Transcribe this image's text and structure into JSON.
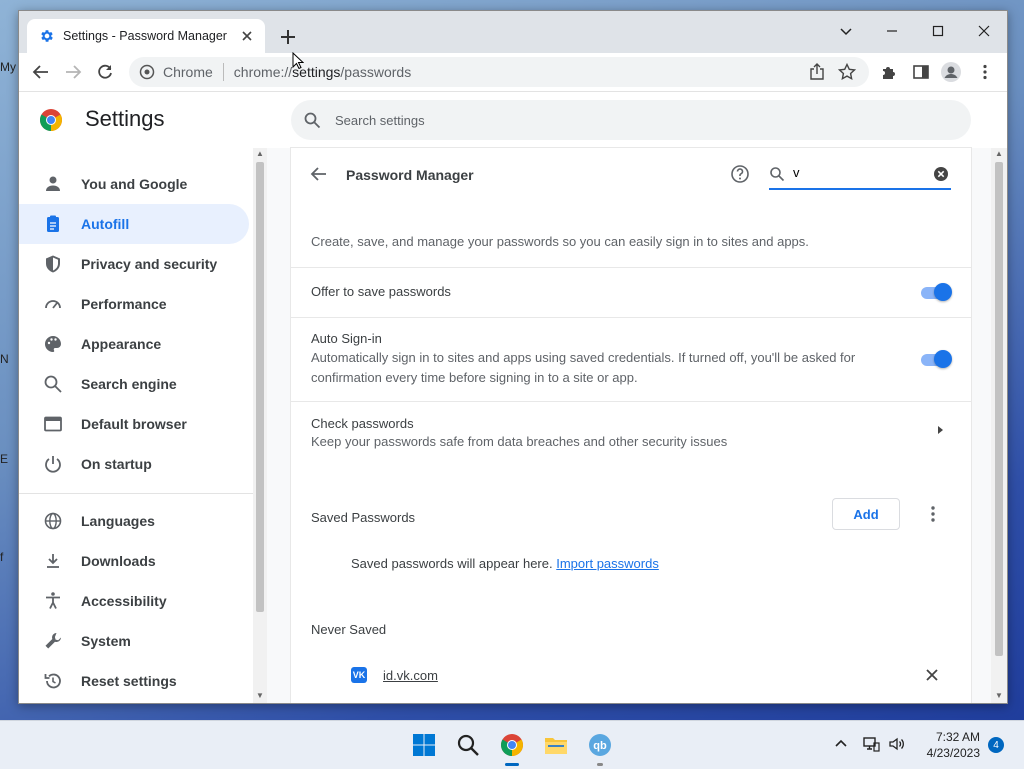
{
  "browser": {
    "tab_title": "Settings - Password Manager",
    "omnibox_chip": "Chrome",
    "url_prefix": "chrome://",
    "url_host": "settings",
    "url_path": "/passwords"
  },
  "settings": {
    "title": "Settings",
    "search_placeholder": "Search settings"
  },
  "sidebar": {
    "items": [
      {
        "label": "You and Google",
        "icon": "person-icon"
      },
      {
        "label": "Autofill",
        "icon": "clipboard-icon",
        "active": true
      },
      {
        "label": "Privacy and security",
        "icon": "shield-icon"
      },
      {
        "label": "Performance",
        "icon": "speedometer-icon"
      },
      {
        "label": "Appearance",
        "icon": "palette-icon"
      },
      {
        "label": "Search engine",
        "icon": "search-icon"
      },
      {
        "label": "Default browser",
        "icon": "browser-window-icon"
      },
      {
        "label": "On startup",
        "icon": "power-icon"
      },
      {
        "label": "Languages",
        "icon": "globe-icon"
      },
      {
        "label": "Downloads",
        "icon": "download-icon"
      },
      {
        "label": "Accessibility",
        "icon": "accessibility-icon"
      },
      {
        "label": "System",
        "icon": "wrench-icon"
      },
      {
        "label": "Reset settings",
        "icon": "restore-icon"
      }
    ]
  },
  "password_manager": {
    "title": "Password Manager",
    "search_value": "v",
    "description": "Create, save, and manage your passwords so you can easily sign in to sites and apps.",
    "offer_to_save": {
      "label": "Offer to save passwords",
      "enabled": true
    },
    "auto_signin": {
      "label": "Auto Sign-in",
      "sub": "Automatically sign in to sites and apps using saved credentials. If turned off, you'll be asked for confirmation every time before signing in to a site or app.",
      "enabled": true
    },
    "check_passwords": {
      "label": "Check passwords",
      "sub": "Keep your passwords safe from data breaches and other security issues"
    },
    "saved_passwords": {
      "heading": "Saved Passwords",
      "add_label": "Add",
      "empty_text": "Saved passwords will appear here.",
      "import_link": "Import passwords"
    },
    "never_saved": {
      "heading": "Never Saved",
      "sites": [
        {
          "site": "id.vk.com",
          "icon_text": "VK"
        }
      ]
    }
  },
  "taskbar": {
    "time": "7:32 AM",
    "date": "4/23/2023",
    "notification_count": "4"
  },
  "colors": {
    "accent": "#1a73e8",
    "toggle_track": "#8ab4f8",
    "active_nav_bg": "#e8f0fe"
  }
}
